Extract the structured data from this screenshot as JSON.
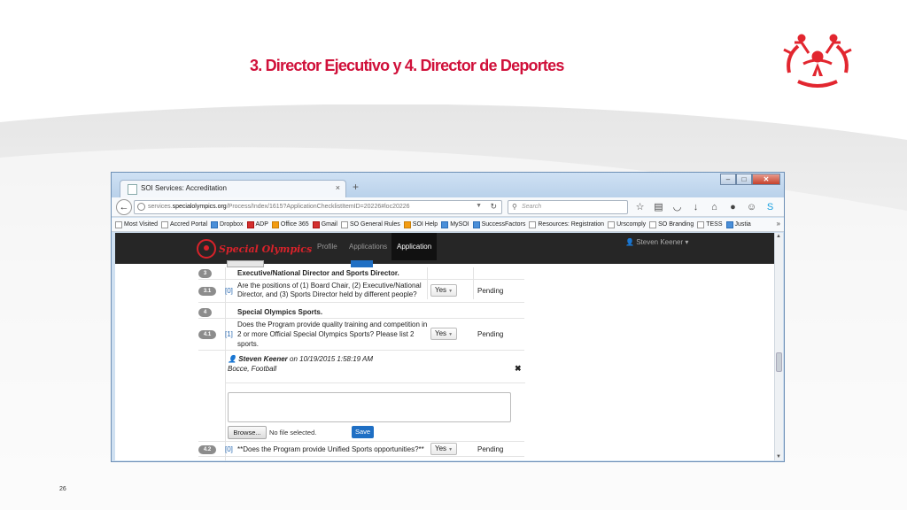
{
  "slide": {
    "title": "3. Director Ejecutivo y 4. Director de Deportes",
    "page_number": "26"
  },
  "browser": {
    "tab_title": "SOI Services: Accreditation",
    "tab_close": "×",
    "new_tab": "+",
    "window_buttons": [
      "–",
      "□",
      "✕"
    ],
    "url_prefix": "services.",
    "url_domain": "specialolympics.org",
    "url_path": "/Process/Index/1615?ApplicationChecklistItemID=20226#loc20226",
    "search_placeholder": "Search",
    "bookmarks": [
      {
        "label": "Most Visited",
        "icon": "folder-icon"
      },
      {
        "label": "Accred Portal",
        "icon": "page-icon"
      },
      {
        "label": "Dropbox",
        "icon": "dropbox-icon"
      },
      {
        "label": "ADP",
        "icon": "adp-icon"
      },
      {
        "label": "Office 365",
        "icon": "office-icon"
      },
      {
        "label": "Gmail",
        "icon": "gmail-icon"
      },
      {
        "label": "SO General Rules",
        "icon": "page-icon"
      },
      {
        "label": "SOI Help",
        "icon": "help-icon"
      },
      {
        "label": "MySOI",
        "icon": "soi-icon"
      },
      {
        "label": "SuccessFactors",
        "icon": "sf-icon"
      },
      {
        "label": "Resources: Registration",
        "icon": "page-icon"
      },
      {
        "label": "Urscomply",
        "icon": "a-icon"
      },
      {
        "label": "SO Branding",
        "icon": "page-icon"
      },
      {
        "label": "TESS",
        "icon": "page-icon"
      },
      {
        "label": "Justia",
        "icon": "justia-icon"
      }
    ],
    "bookmarks_more": "»"
  },
  "app": {
    "brand": "Special Olympics",
    "nav": {
      "profile": "Profile",
      "applications": "Applications",
      "application": "Application"
    },
    "user": "Steven Keener"
  },
  "rows": {
    "s3": {
      "badge": "3",
      "text": "Executive/National Director and Sports Director."
    },
    "r31": {
      "badge": "3.1",
      "link": "[0]",
      "line1": "Are the positions of (1) Board Chair, (2) Executive/National",
      "line2": "Director, and (3) Sports Director held by different people?",
      "answer": "Yes",
      "status": "Pending"
    },
    "s4": {
      "badge": "4",
      "text": "Special Olympics Sports."
    },
    "r41": {
      "badge": "4.1",
      "link": "[1]",
      "line1": "Does the Program provide quality training and competition in",
      "line2": "2 or more Official Special Olympics Sports? Please list 2",
      "line3": "sports.",
      "answer": "Yes",
      "status": "Pending"
    },
    "r42": {
      "badge": "4.2",
      "link": "[0]",
      "text": "**Does the Program provide Unified Sports opportunities?**",
      "answer": "Yes",
      "status": "Pending"
    }
  },
  "comment": {
    "author": "Steven Keener",
    "date_prefix": "on 10/19/2015 1:58:19 AM",
    "body": "Bocce, Football",
    "browse_label": "Browse...",
    "file_label": "No file selected.",
    "save_label": "Save"
  },
  "colors": {
    "title_red": "#d0103a",
    "logo_red": "#e2262f",
    "nav_dark": "#262626",
    "save_blue": "#1f6fc4"
  }
}
